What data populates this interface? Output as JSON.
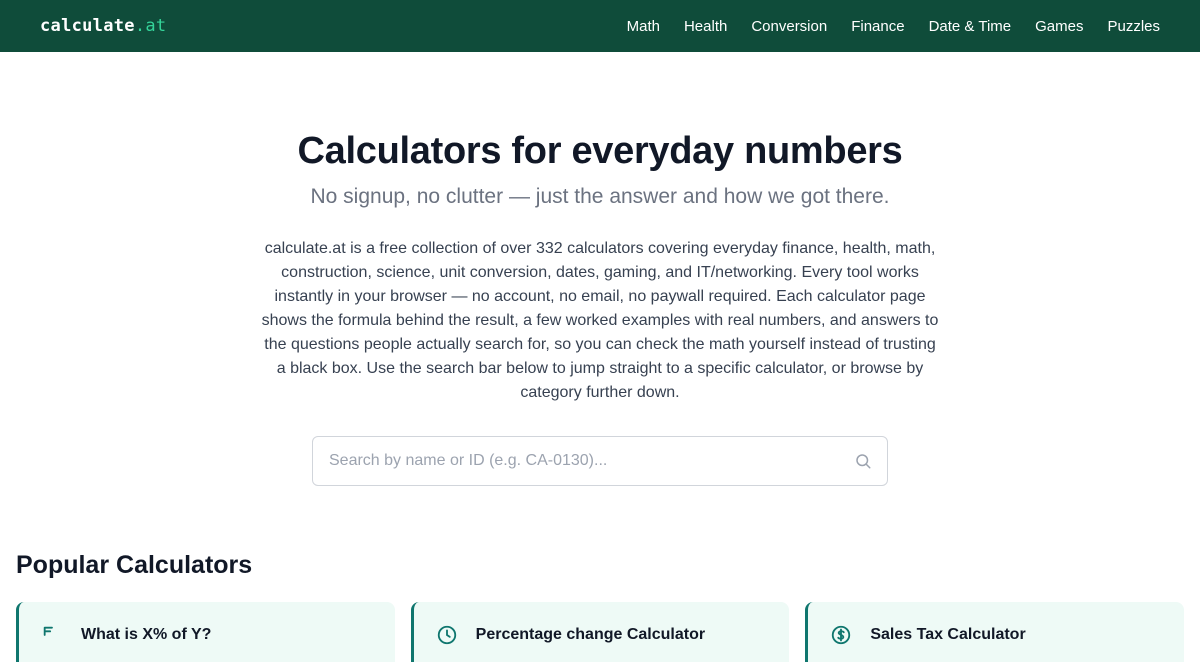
{
  "header": {
    "logo_name": "calculate",
    "logo_tld": ".at",
    "nav": [
      "Math",
      "Health",
      "Conversion",
      "Finance",
      "Date & Time",
      "Games",
      "Puzzles"
    ]
  },
  "hero": {
    "title": "Calculators for everyday numbers",
    "subtitle": "No signup, no clutter — just the answer and how we got there.",
    "intro": "calculate.at is a free collection of over 332 calculators covering everyday finance, health, math, construction, science, unit conversion, dates, gaming, and IT/networking. Every tool works instantly in your browser — no account, no email, no paywall required. Each calculator page shows the formula behind the result, a few worked examples with real numbers, and answers to the questions people actually search for, so you can check the math yourself instead of trusting a black box. Use the search bar below to jump straight to a specific calculator, or browse by category further down."
  },
  "search": {
    "placeholder": "Search by name or ID (e.g. CA-0130)...",
    "value": "",
    "icon": "search-icon"
  },
  "popular": {
    "title": "Popular Calculators",
    "cards": [
      {
        "label": "What is X% of Y?",
        "icon": "percent-icon"
      },
      {
        "label": "Percentage change Calculator",
        "icon": "clock-icon"
      },
      {
        "label": "Sales Tax Calculator",
        "icon": "dollar-icon"
      }
    ]
  },
  "colors": {
    "header_bg": "#0f4c3a",
    "accent": "#34d399",
    "card_bg": "#eefaf6",
    "card_border": "#0f766e"
  }
}
